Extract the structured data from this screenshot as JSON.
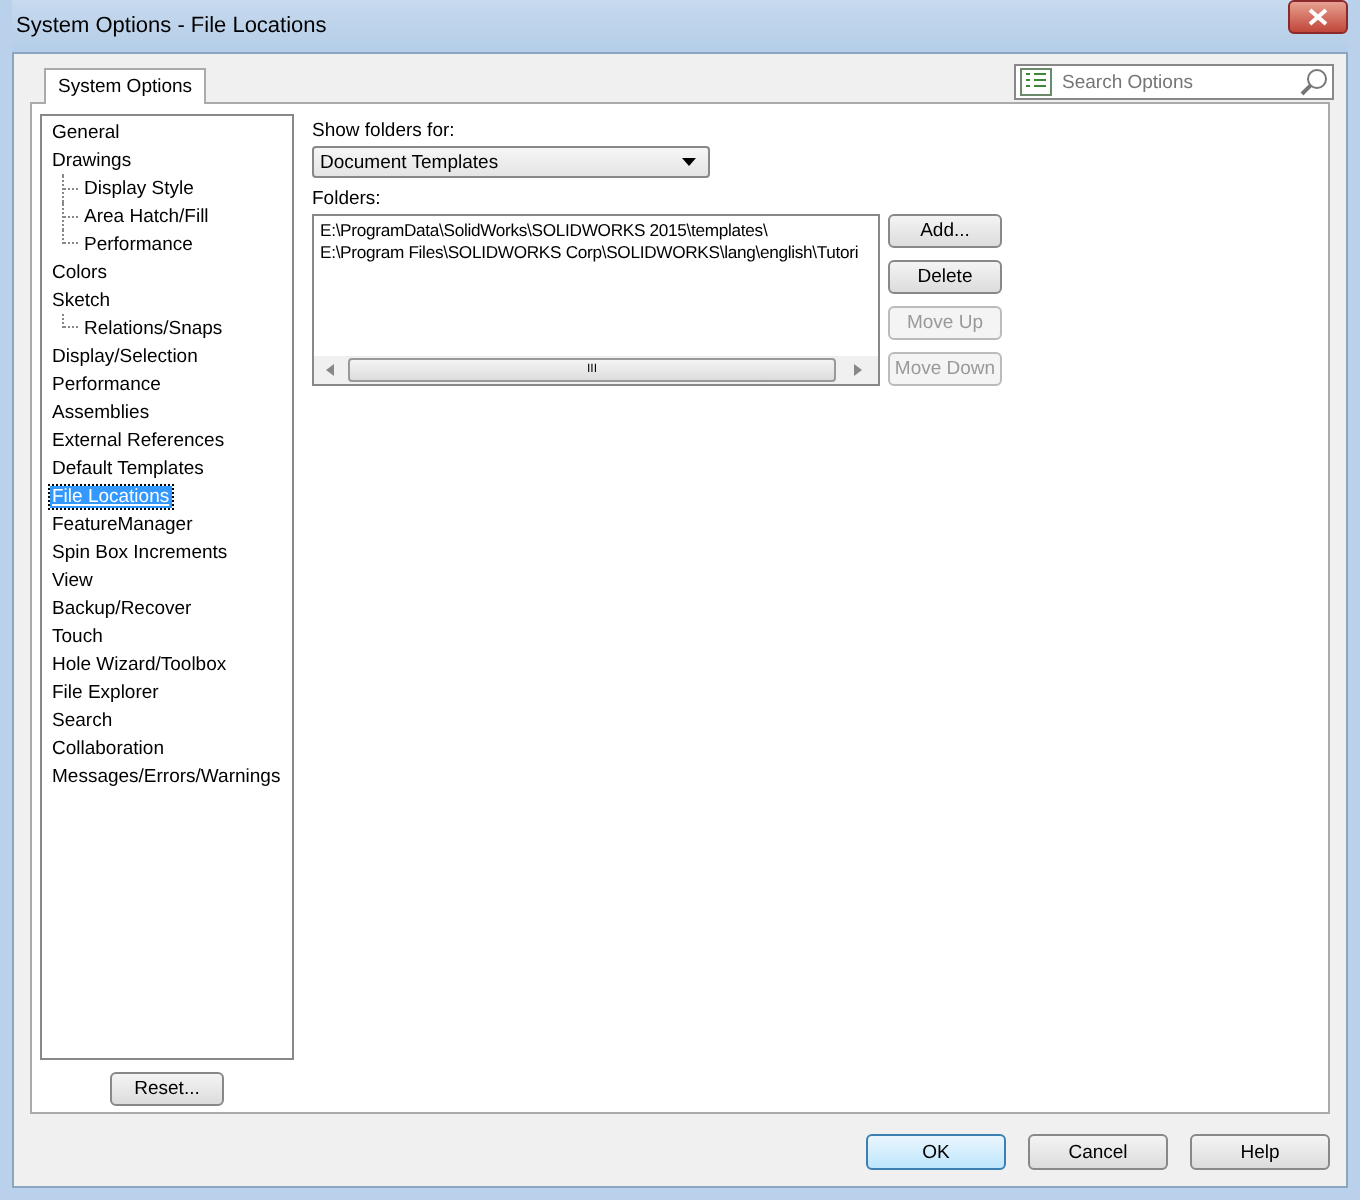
{
  "window": {
    "title": "System Options - File Locations"
  },
  "tabs": [
    {
      "label": "System Options",
      "selected": true
    }
  ],
  "search": {
    "placeholder": "Search Options"
  },
  "sidebar": {
    "items": [
      {
        "label": "General",
        "selected": false
      },
      {
        "label": "Drawings",
        "selected": false,
        "children": [
          {
            "label": "Display Style",
            "selected": false
          },
          {
            "label": "Area Hatch/Fill",
            "selected": false
          },
          {
            "label": "Performance",
            "selected": false
          }
        ]
      },
      {
        "label": "Colors",
        "selected": false
      },
      {
        "label": "Sketch",
        "selected": false,
        "children": [
          {
            "label": "Relations/Snaps",
            "selected": false
          }
        ]
      },
      {
        "label": "Display/Selection",
        "selected": false
      },
      {
        "label": "Performance",
        "selected": false
      },
      {
        "label": "Assemblies",
        "selected": false
      },
      {
        "label": "External References",
        "selected": false
      },
      {
        "label": "Default Templates",
        "selected": false
      },
      {
        "label": "File Locations",
        "selected": true
      },
      {
        "label": "FeatureManager",
        "selected": false
      },
      {
        "label": "Spin Box Increments",
        "selected": false
      },
      {
        "label": "View",
        "selected": false
      },
      {
        "label": "Backup/Recover",
        "selected": false
      },
      {
        "label": "Touch",
        "selected": false
      },
      {
        "label": "Hole Wizard/Toolbox",
        "selected": false
      },
      {
        "label": "File Explorer",
        "selected": false
      },
      {
        "label": "Search",
        "selected": false
      },
      {
        "label": "Collaboration",
        "selected": false
      },
      {
        "label": "Messages/Errors/Warnings",
        "selected": false
      }
    ],
    "reset_button": "Reset..."
  },
  "show_folders_for": {
    "label": "Show folders for:",
    "value": "Document Templates"
  },
  "folders": {
    "label": "Folders:",
    "items": [
      "E:\\ProgramData\\SolidWorks\\SOLIDWORKS 2015\\templates\\",
      "E:\\Program Files\\SOLIDWORKS Corp\\SOLIDWORKS\\lang\\english\\Tutori"
    ],
    "buttons": [
      {
        "label": "Add...",
        "disabled": false
      },
      {
        "label": "Delete",
        "disabled": false
      },
      {
        "label": "Move Up",
        "disabled": true
      },
      {
        "label": "Move Down",
        "disabled": true
      }
    ],
    "scroll_thumb_glyph": "III"
  },
  "footer_buttons": [
    {
      "label": "OK",
      "default": true
    },
    {
      "label": "Cancel",
      "default": false
    },
    {
      "label": "Help",
      "default": false
    }
  ]
}
